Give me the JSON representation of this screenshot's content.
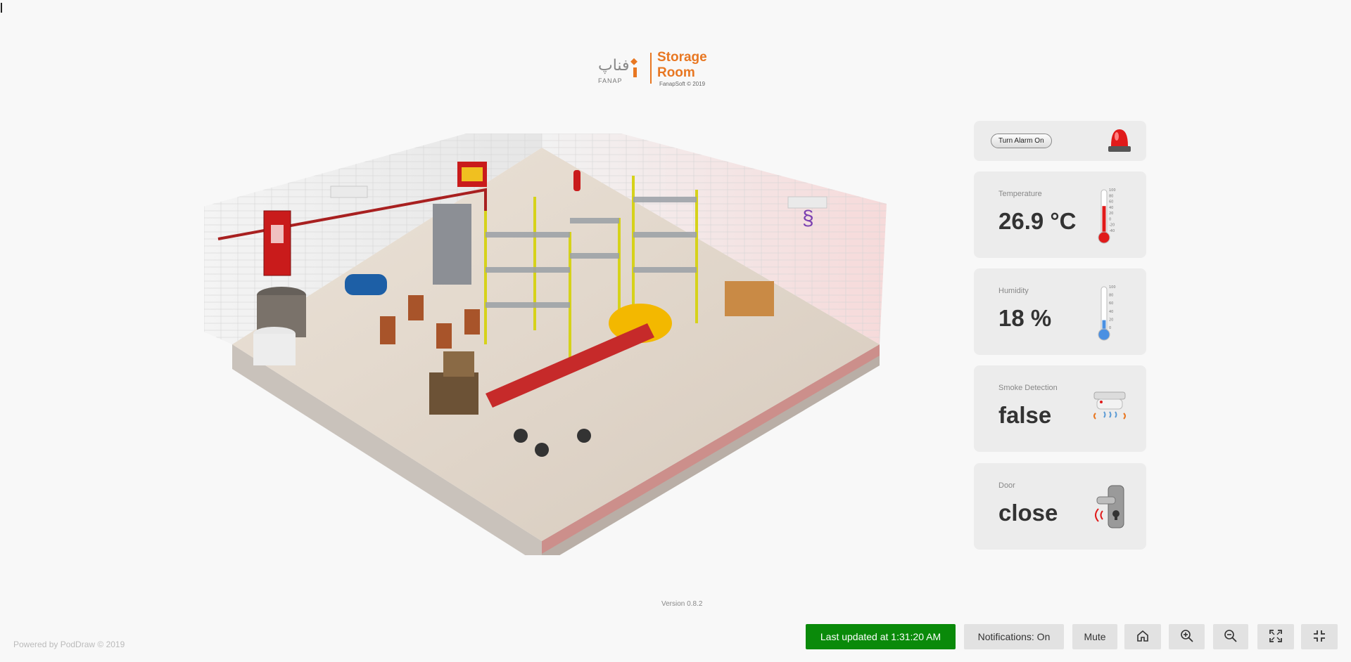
{
  "header": {
    "logo_text": "FANAP",
    "title": "Storage Room",
    "copyright": "FanapSoft © 2019"
  },
  "alarm": {
    "button_label": "Turn Alarm On",
    "icon": "siren-icon"
  },
  "metrics": [
    {
      "label": "Temperature",
      "value": "26.9 °C",
      "icon": "thermometer-icon",
      "level": 0.6
    },
    {
      "label": "Humidity",
      "value": "18 %",
      "icon": "thermometer-icon",
      "level": 0.18
    },
    {
      "label": "Smoke Detection",
      "value": "false",
      "icon": "smoke-detector-icon"
    },
    {
      "label": "Door",
      "value": "close",
      "icon": "door-lock-icon"
    }
  ],
  "thermometer_scale": [
    "100",
    "80",
    "60",
    "40",
    "20",
    "0",
    "-20",
    "-40"
  ],
  "humidity_scale": [
    "100",
    "80",
    "60",
    "40",
    "20",
    "0"
  ],
  "footer": {
    "version": "Version 0.8.2",
    "powered_by": "Powered by PodDraw © 2019",
    "last_updated": "Last updated at 1:31:20 AM",
    "notifications": "Notifications: On",
    "mute": "Mute"
  },
  "toolbar_icons": [
    "home-icon",
    "zoom-in-icon",
    "zoom-out-icon",
    "fullscreen-icon",
    "exit-fullscreen-icon"
  ],
  "colors": {
    "accent": "#e87722",
    "success": "#0a8a0a",
    "alarm_red": "#e01a1a"
  }
}
